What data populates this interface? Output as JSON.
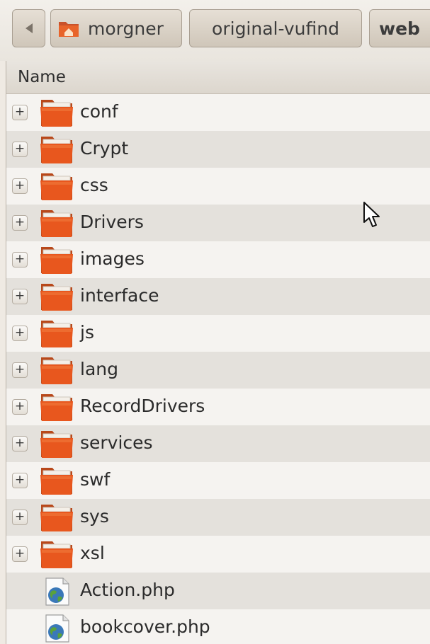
{
  "pathbar": {
    "back_icon": "left-arrow-icon",
    "segments": [
      {
        "label": "morgner",
        "icon": "home-folder-icon"
      },
      {
        "label": "original-vufind"
      },
      {
        "label": "web"
      }
    ]
  },
  "list": {
    "column_header": "Name",
    "items": [
      {
        "name": "conf",
        "type": "folder",
        "expander": "+"
      },
      {
        "name": "Crypt",
        "type": "folder",
        "expander": "+"
      },
      {
        "name": "css",
        "type": "folder",
        "expander": "+"
      },
      {
        "name": "Drivers",
        "type": "folder",
        "expander": "+"
      },
      {
        "name": "images",
        "type": "folder",
        "expander": "+"
      },
      {
        "name": "interface",
        "type": "folder",
        "expander": "+"
      },
      {
        "name": "js",
        "type": "folder",
        "expander": "+"
      },
      {
        "name": "lang",
        "type": "folder",
        "expander": "+"
      },
      {
        "name": "RecordDrivers",
        "type": "folder",
        "expander": "+"
      },
      {
        "name": "services",
        "type": "folder",
        "expander": "+"
      },
      {
        "name": "swf",
        "type": "folder",
        "expander": "+"
      },
      {
        "name": "sys",
        "type": "folder",
        "expander": "+"
      },
      {
        "name": "xsl",
        "type": "folder",
        "expander": "+"
      },
      {
        "name": "Action.php",
        "type": "php-file"
      },
      {
        "name": "bookcover.php",
        "type": "php-file"
      }
    ]
  },
  "colors": {
    "folder_orange": "#e8571e",
    "row_alt": "#e4e1dc",
    "row_base": "#f5f3f0"
  }
}
